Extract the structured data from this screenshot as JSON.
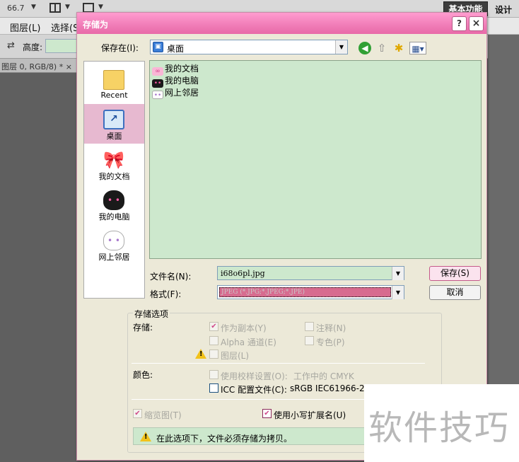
{
  "app": {
    "zoom_value": "66.7",
    "workspace_active": "基本功能",
    "workspace_design": "设计",
    "menu": [
      "图层(L)",
      "选择(S"
    ],
    "option_label": "高度:",
    "doc_tab": "图层 0, RGB/8) * ×"
  },
  "dialog": {
    "title": "存储为",
    "help_label": "?",
    "close_label": "×",
    "lookin_label": "保存在(I):",
    "lookin_value": "桌面",
    "places": [
      {
        "label": "Recent",
        "icon": "folder-icon"
      },
      {
        "label": "桌面",
        "icon": "desktop-icon"
      },
      {
        "label": "我的文档",
        "icon": "pink-bow-icon"
      },
      {
        "label": "我的电脑",
        "icon": "black-kitty-icon"
      },
      {
        "label": "网上邻居",
        "icon": "white-kitty-icon"
      }
    ],
    "files": [
      {
        "name": "我的文档",
        "icon": "pink-bow-icon"
      },
      {
        "name": "我的电脑",
        "icon": "black-kitty-icon"
      },
      {
        "name": "网上邻居",
        "icon": "white-kitty-icon"
      }
    ],
    "filename_label": "文件名(N):",
    "filename_value": "i68o6pl.jpg",
    "format_label": "格式(F):",
    "format_value": "JPEG (*.JPG;*.JPEG;*.JPE)",
    "save_button": "保存(S)",
    "cancel_button": "取消"
  },
  "options": {
    "group_title": "存储选项",
    "save_label": "存储:",
    "as_copy": {
      "label": "作为副本(Y)",
      "checked": true,
      "disabled": true
    },
    "notes": {
      "label": "注释(N)",
      "checked": false,
      "disabled": true
    },
    "alpha": {
      "label": "Alpha 通道(E)",
      "checked": false,
      "disabled": true
    },
    "spot": {
      "label": "专色(P)",
      "checked": false,
      "disabled": true
    },
    "layers": {
      "label": "图层(L)",
      "checked": false,
      "disabled": true
    },
    "color_label": "颜色:",
    "proof": {
      "label": "使用校样设置(O):",
      "extra": "工作中的 CMYK",
      "checked": false,
      "disabled": true
    },
    "icc": {
      "label": "ICC 配置文件(C):",
      "extra": "sRGB IEC61966-2.1",
      "checked": false,
      "disabled": false
    },
    "thumbnail": {
      "label": "缩览图(T)",
      "checked": true,
      "disabled": true
    },
    "lowercase": {
      "label": "使用小写扩展名(U)",
      "checked": true,
      "disabled": false
    },
    "warning_text": "在此选项下，文件必须存储为拷贝。"
  },
  "watermark": "软件技巧",
  "colors": {
    "title_pink": "#f07cb7",
    "mint": "#cde8cd",
    "selection_pink": "#e7b9d0"
  }
}
